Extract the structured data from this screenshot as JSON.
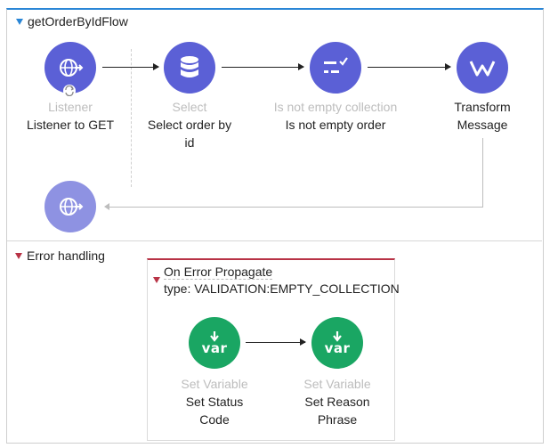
{
  "flow": {
    "name": "getOrderByIdFlow",
    "nodes": [
      {
        "type": "Listener",
        "name": "Listener to GET",
        "icon": "globe-arrow-icon"
      },
      {
        "type": "Select",
        "name": "Select order by id",
        "name_lines": [
          "Select order by",
          "id"
        ],
        "icon": "database-icon"
      },
      {
        "type": "Is not empty collection",
        "name": "Is not empty order",
        "icon": "validation-icon"
      },
      {
        "type": "",
        "name": "Transform Message",
        "name_lines": [
          "Transform",
          "Message"
        ],
        "icon": "transform-icon"
      }
    ],
    "response_icon": "globe-arrow-icon"
  },
  "error_handling": {
    "label": "Error handling",
    "scope": {
      "title": "On Error Propagate",
      "type": "type: VALIDATION:EMPTY_COLLECTION",
      "nodes": [
        {
          "type": "Set Variable",
          "name": "Set Status Code",
          "name_lines": [
            "Set Status",
            "Code"
          ],
          "icon_text": "var"
        },
        {
          "type": "Set Variable",
          "name": "Set Reason Phrase",
          "name_lines": [
            "Set Reason",
            "Phrase"
          ],
          "icon_text": "var"
        }
      ]
    }
  },
  "colors": {
    "accent": "#2a86d6",
    "node_purple": "#5b60d6",
    "node_green": "#1aa663",
    "error_red": "#b83346"
  }
}
